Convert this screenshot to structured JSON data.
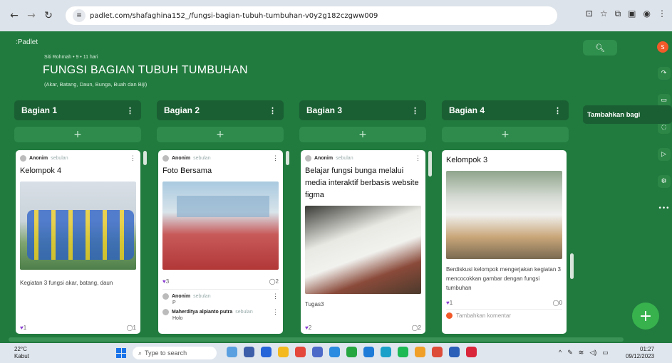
{
  "browser": {
    "url": "padlet.com/shafaghina152_/fungsi-bagian-tubuh-tumbuhan-v0y2g182czgww009"
  },
  "padlet": {
    "brand": ":Padlet",
    "meta": "Siti Rohmah • 9 • 11 hari",
    "title": "FUNGSI BAGIAN TUBUH TUMBUHAN",
    "subtitle": "(Akar, Batang, Daun, Bunga, Buah dan Biji)",
    "user_initial": "S",
    "add_section": "Tambahkan bagi",
    "columns": [
      {
        "label": "Bagian 1"
      },
      {
        "label": "Bagian 2"
      },
      {
        "label": "Bagian 3"
      },
      {
        "label": "Bagian 4"
      }
    ],
    "cards": [
      {
        "author": "Anonim",
        "ago": "sebulan",
        "title": "Kelompok 4",
        "body": "Kegiatan 3 fungsi akar, batang, daun",
        "likes": "1",
        "comments": "1"
      },
      {
        "author": "Anonim",
        "ago": "sebulan",
        "title": "Foto Bersama",
        "body": "",
        "likes": "3",
        "comments": "2",
        "reply1_author": "Anonim",
        "reply1_ago": "sebulan",
        "reply1_text": "P",
        "reply2_author": "Maherditya alpianto putra",
        "reply2_ago": "sebulan",
        "reply2_text": "Holo"
      },
      {
        "author": "Anonim",
        "ago": "sebulan",
        "title": "Belajar fungsi bunga melalui media interaktif berbasis website figma",
        "body": "Tugas3",
        "likes": "2",
        "comments": "2"
      },
      {
        "author": "",
        "ago": "",
        "title": "Kelompok 3",
        "body": "Berdiskusi kelompok mengerjakan kegiatan 3 mencocokkan gambar dengan fungsi tumbuhan",
        "likes": "1",
        "comments": "0",
        "add_comment": "Tambahkan komentar"
      }
    ]
  },
  "taskbar": {
    "temp": "22°C",
    "weather": "Kabut",
    "search_placeholder": "Type to search",
    "time": "01:27",
    "date": "09/12/2023"
  }
}
